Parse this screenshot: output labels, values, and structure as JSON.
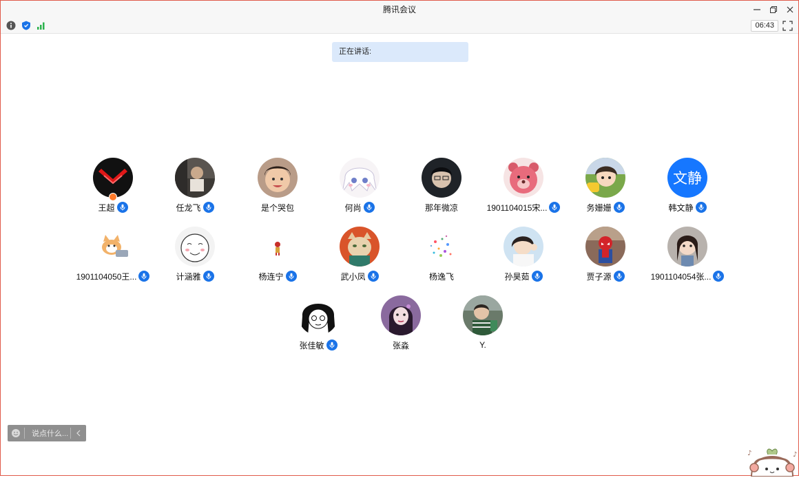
{
  "window": {
    "title": "腾讯会议"
  },
  "toolbar": {
    "time": "06:43",
    "icons": [
      "info-icon",
      "shield-icon",
      "signal-icon"
    ]
  },
  "speaking": {
    "label": "正在讲话:"
  },
  "participants": [
    {
      "name": "王超",
      "mic": true,
      "host": true,
      "avatar": "red-chevron"
    },
    {
      "name": "任龙飞",
      "mic": true,
      "avatar": "photo-dark"
    },
    {
      "name": "是个哭包",
      "mic": false,
      "avatar": "photo-girl"
    },
    {
      "name": "何尚",
      "mic": true,
      "avatar": "anime-white"
    },
    {
      "name": "那年微凉",
      "mic": false,
      "avatar": "photo-boy-dark"
    },
    {
      "name": "1901104015宋...",
      "mic": true,
      "avatar": "pink-bear"
    },
    {
      "name": "务姗姗",
      "mic": true,
      "avatar": "cartoon-boy"
    },
    {
      "name": "韩文静",
      "mic": true,
      "avatar": "text",
      "avatar_text": "文静",
      "avatar_color": "#1677ff"
    },
    {
      "name": "1901104050王...",
      "mic": true,
      "avatar": "cat-laptop"
    },
    {
      "name": "计涵雅",
      "mic": true,
      "avatar": "doodle-face"
    },
    {
      "name": "杨连宁",
      "mic": true,
      "avatar": "tiny-figure"
    },
    {
      "name": "武小凤",
      "mic": true,
      "avatar": "cat-orange"
    },
    {
      "name": "杨逸飞",
      "mic": false,
      "avatar": "confetti"
    },
    {
      "name": "孙昊茹",
      "mic": true,
      "avatar": "photo-girl-light"
    },
    {
      "name": "贾子源",
      "mic": true,
      "avatar": "spiderman"
    },
    {
      "name": "1901104054张...",
      "mic": true,
      "avatar": "photo-girl-braid"
    },
    {
      "name": "张佳敏",
      "mic": true,
      "avatar": "manga-girl"
    },
    {
      "name": "张淼",
      "mic": false,
      "avatar": "purple-girl"
    },
    {
      "name": "Y.",
      "mic": false,
      "avatar": "photo-guy-green"
    }
  ],
  "chat": {
    "placeholder": "说点什么..."
  }
}
